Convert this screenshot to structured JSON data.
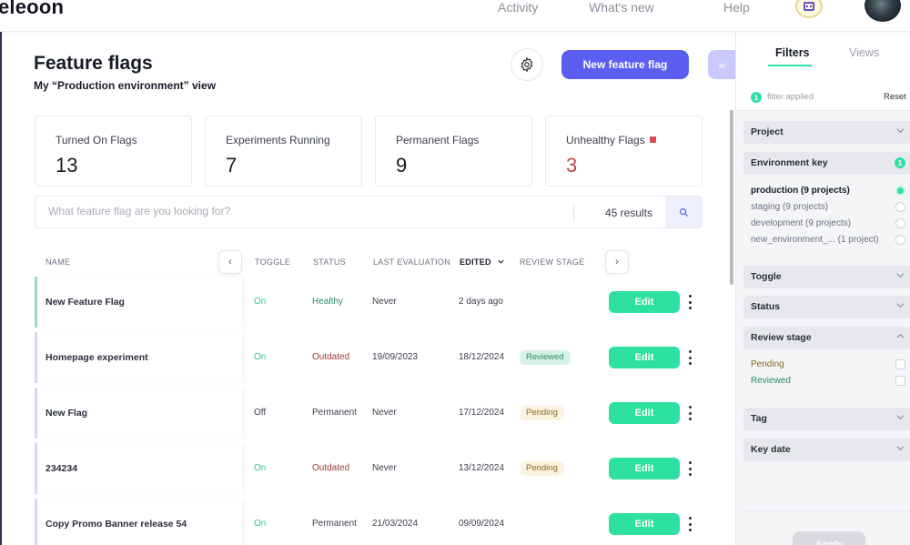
{
  "topbar": {
    "brand": "eleoon",
    "nav": [
      "Activity",
      "What's new",
      "Help"
    ]
  },
  "header": {
    "title": "Feature flags",
    "subtitle": "My “Production environment” view",
    "new_button": "New feature flag"
  },
  "stats": [
    {
      "label": "Turned On Flags",
      "value": "13"
    },
    {
      "label": "Experiments Running",
      "value": "7"
    },
    {
      "label": "Permanent Flags",
      "value": "9"
    },
    {
      "label": "Unhealthy Flags",
      "value": "3"
    }
  ],
  "search": {
    "placeholder": "What feature flag are you looking for?",
    "results": "45 results"
  },
  "table": {
    "columns": [
      "NAME",
      "TOGGLE",
      "STATUS",
      "LAST EVALUATION",
      "EDITED",
      "REVIEW STAGE"
    ],
    "edit_label": "Edit",
    "rows": [
      {
        "name": "New Feature Flag",
        "toggle": "On",
        "status": "Healthy",
        "last_evaluation": "Never",
        "edited": "2 days ago",
        "review": ""
      },
      {
        "name": "Homepage experiment",
        "toggle": "On",
        "status": "Outdated",
        "last_evaluation": "19/09/2023",
        "edited": "18/12/2024",
        "review": "Reviewed"
      },
      {
        "name": "New Flag",
        "toggle": "Off",
        "status": "Permanent",
        "last_evaluation": "Never",
        "edited": "17/12/2024",
        "review": "Pending"
      },
      {
        "name": "234234",
        "toggle": "On",
        "status": "Outdated",
        "last_evaluation": "Never",
        "edited": "13/12/2024",
        "review": "Pending"
      },
      {
        "name": "Copy Promo Banner release 54",
        "toggle": "On",
        "status": "Permanent",
        "last_evaluation": "21/03/2024",
        "edited": "09/09/2024",
        "review": ""
      }
    ]
  },
  "panel": {
    "tabs": [
      "Filters",
      "Views"
    ],
    "applied_count": "1",
    "applied_text": "filter applied",
    "reset": "Reset",
    "sections": {
      "project": "Project",
      "env_key": "Environment key",
      "env_key_count": "1",
      "toggle": "Toggle",
      "status": "Status",
      "review_stage": "Review stage",
      "tag": "Tag",
      "key_date": "Key date"
    },
    "env_options": [
      "production (9 projects)",
      "staging (9 projects)",
      "development (9 projects)",
      "new_environment_... (1 project)"
    ],
    "review_options": [
      "Pending",
      "Reviewed"
    ],
    "apply": "Apply"
  },
  "colors": {
    "primary": "#5b5ef0",
    "accent_green": "#2ee0a0",
    "alert_red": "#c0454c"
  }
}
